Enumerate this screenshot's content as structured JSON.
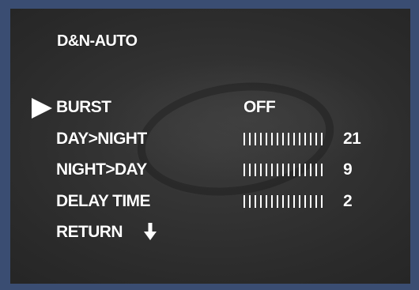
{
  "menu": {
    "title": "D&N-AUTO",
    "items": [
      {
        "label": "BURST",
        "value": "OFF"
      },
      {
        "label": "DAY>NIGHT",
        "value": "21",
        "ticks": 15
      },
      {
        "label": "NIGHT>DAY",
        "value": "9",
        "ticks": 15
      },
      {
        "label": "DELAY TIME",
        "value": "2",
        "ticks": 15
      },
      {
        "label": "RETURN",
        "icon": "down-arrow-icon"
      }
    ],
    "selected_index": 0,
    "cursor_icon": "right-triangle-cursor-icon"
  },
  "colors": {
    "frame": "#3a4d72",
    "text": "#ffffff"
  }
}
